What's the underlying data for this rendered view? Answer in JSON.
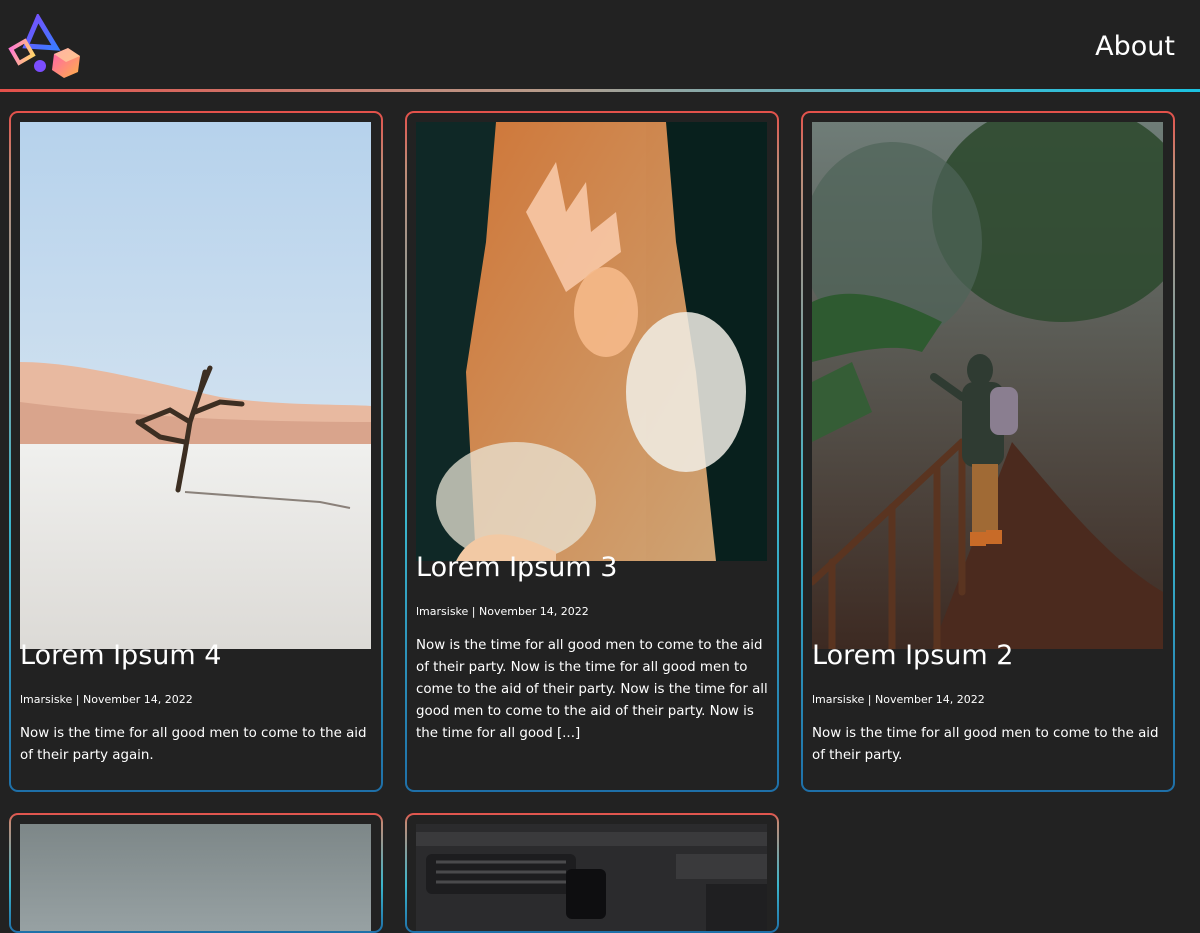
{
  "header": {
    "logo": "geometric-shapes-logo",
    "nav": [
      {
        "label": "About"
      }
    ]
  },
  "posts": [
    {
      "title": "Lorem Ipsum 4",
      "author": "lmarsiske",
      "date": "November 14, 2022",
      "excerpt": "Now is the time for all good men to come to the aid of their party again.",
      "image": "dead-tree-desert-photo"
    },
    {
      "title": "Lorem Ipsum 3",
      "author": "lmarsiske",
      "date": "November 14, 2022",
      "excerpt": "Now is the time for all good men to come to the aid of their party. Now is the time for all good men to come to the aid of their party. Now is the time for all good men to come to the aid of their party. Now is the time for all good [...]",
      "image": "woman-orange-veil-photo"
    },
    {
      "title": "Lorem Ipsum 2",
      "author": "lmarsiske",
      "date": "November 14, 2022",
      "excerpt": "Now is the time for all good men to come to the aid of their party.",
      "image": "hiker-misty-forest-photo"
    },
    {
      "title": "",
      "image": "grey-sky-photo"
    },
    {
      "title": "",
      "image": "car-dashboard-photo"
    }
  ],
  "colors": {
    "background": "#222222",
    "gradient_start": "#e4504a",
    "gradient_mid": "#3bb6cc",
    "gradient_end": "#1e6fa8"
  }
}
